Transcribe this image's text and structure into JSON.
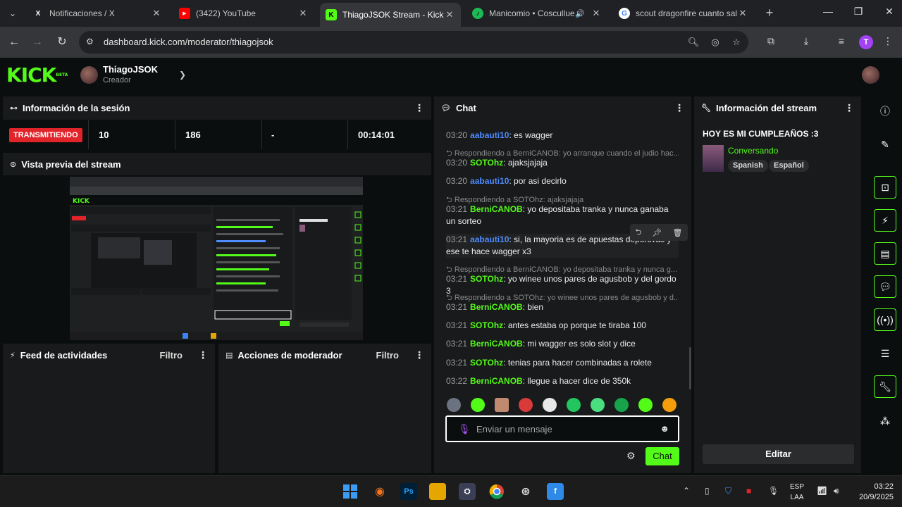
{
  "browser": {
    "tabs": [
      {
        "title": "Notificaciones / X",
        "icon": "x-logo-icon",
        "fav": "X",
        "color": "#000000"
      },
      {
        "title": "(3422) YouTube",
        "icon": "youtube-icon",
        "fav": "▶",
        "color": "#ff0000"
      },
      {
        "title": "ThiagoJSOK Stream - Kick D",
        "icon": "kick-icon",
        "fav": "K",
        "color": "#53fc18"
      },
      {
        "title": "Manicomio • Cosculluela",
        "icon": "spotify-icon",
        "fav": "♪",
        "color": "#1db954"
      },
      {
        "title": "scout dragonfire cuanto sale",
        "icon": "google-icon",
        "fav": "G",
        "color": "#ffffff"
      }
    ],
    "url": "dashboard.kick.com/moderator/thiagojsok",
    "profile_initial": "T"
  },
  "kick": {
    "logo": "KICK",
    "logo_badge": "BETA",
    "channel_name": "ThiagoJSOK",
    "channel_role": "Creador",
    "brand_color": "#53fc18"
  },
  "session": {
    "title": "Información de la sesión",
    "live_label": "TRANSMITIENDO",
    "stats": [
      "10",
      "186",
      "-",
      "00:14:01"
    ]
  },
  "preview": {
    "title": "Vista previa del stream"
  },
  "activity": {
    "title": "Feed de actividades",
    "filter": "Filtro"
  },
  "modactions": {
    "title": "Acciones de moderador",
    "filter": "Filtro"
  },
  "chat": {
    "title": "Chat",
    "messages": [
      {
        "time": "03:20",
        "user": "aabauti10",
        "color": "#4e8cff",
        "text": ": es wagger",
        "reply": ""
      },
      {
        "time": "03:20",
        "user": "SOTOhz",
        "color": "#53fc18",
        "text": ": ajaksjajaja",
        "reply": "Respondiendo a BerniCANOB: yo arranque cuando el judio hac..."
      },
      {
        "time": "03:20",
        "user": "aabauti10",
        "color": "#4e8cff",
        "text": ": por asi decirlo",
        "reply": ""
      },
      {
        "time": "03:21",
        "user": "BerniCANOB",
        "color": "#53fc18",
        "text": ": yo depositaba tranka y nunca ganaba un sorteo",
        "reply": "Respondiendo a SOTOhz: ajaksjajaja"
      },
      {
        "time": "03:21",
        "user": "aabauti10",
        "color": "#4e8cff",
        "text": ": si, la mayoria es de apuestas deportivas y ese te hace wagger x3",
        "reply": ""
      },
      {
        "time": "03:21",
        "user": "SOTOhz",
        "color": "#53fc18",
        "text": ": yo winee unos pares de agusbob y del gordo 3",
        "reply": "Respondiendo a BerniCANOB: yo depositaba tranka y nunca g..."
      },
      {
        "time": "03:21",
        "user": "BerniCANOB",
        "color": "#53fc18",
        "text": ": bien",
        "reply": "Respondiendo a SOTOhz: yo winee unos pares de agusbob y d..."
      },
      {
        "time": "03:21",
        "user": "SOTOhz",
        "color": "#53fc18",
        "text": ": antes estaba op porque te tiraba 100",
        "reply": ""
      },
      {
        "time": "03:21",
        "user": "BerniCANOB",
        "color": "#53fc18",
        "text": ": mi wagger es solo slot y dice",
        "reply": ""
      },
      {
        "time": "03:21",
        "user": "SOTOhz",
        "color": "#53fc18",
        "text": ": tenias para hacer combinadas a rolete",
        "reply": ""
      },
      {
        "time": "03:22",
        "user": "BerniCANOB",
        "color": "#53fc18",
        "text": ": llegue a hacer dice de 350k",
        "reply": ""
      }
    ],
    "input_placeholder": "Enviar un mensaje",
    "send_label": "Chat"
  },
  "stream_info": {
    "title": "Información del stream",
    "stream_title": "HOY ES MI CUMPLEAÑOS :3",
    "category": "Conversando",
    "tags": [
      "Spanish",
      "Español"
    ],
    "edit_label": "Editar"
  },
  "taskbar": {
    "lang_top": "ESP",
    "lang_bottom": "LAA",
    "time": "03:22",
    "date": "20/9/2025"
  }
}
